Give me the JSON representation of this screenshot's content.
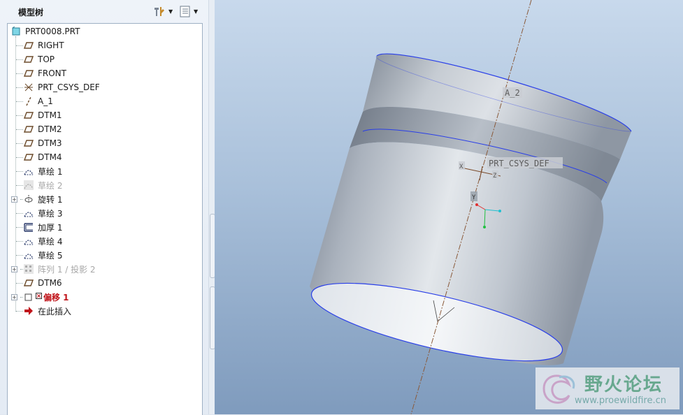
{
  "model_tree": {
    "title": "模型树",
    "root": "PRT0008.PRT",
    "items": [
      {
        "label": "RIGHT",
        "icon": "datum-plane-icon"
      },
      {
        "label": "TOP",
        "icon": "datum-plane-icon"
      },
      {
        "label": "FRONT",
        "icon": "datum-plane-icon"
      },
      {
        "label": "PRT_CSYS_DEF",
        "icon": "coordinate-system-icon"
      },
      {
        "label": "A_1",
        "icon": "datum-axis-icon"
      },
      {
        "label": "DTM1",
        "icon": "datum-plane-icon"
      },
      {
        "label": "DTM2",
        "icon": "datum-plane-icon"
      },
      {
        "label": "DTM3",
        "icon": "datum-plane-icon"
      },
      {
        "label": "DTM4",
        "icon": "datum-plane-icon"
      },
      {
        "label": "草绘 1",
        "icon": "sketch-icon"
      },
      {
        "label": "草绘 2",
        "icon": "sketch-icon",
        "state": "suppressed"
      },
      {
        "label": "旋转 1",
        "icon": "revolve-icon",
        "expandable": true
      },
      {
        "label": "草绘 3",
        "icon": "sketch-icon"
      },
      {
        "label": "加厚 1",
        "icon": "thicken-icon"
      },
      {
        "label": "草绘 4",
        "icon": "sketch-icon"
      },
      {
        "label": "草绘 5",
        "icon": "sketch-icon"
      },
      {
        "label": "阵列 1 / 投影 2",
        "icon": "pattern-icon",
        "state": "suppressed",
        "expandable": true
      },
      {
        "label": "DTM6",
        "icon": "datum-plane-icon"
      },
      {
        "label": "偏移 1",
        "icon": "offset-icon",
        "state": "error",
        "expandable": true
      },
      {
        "label": "在此插入",
        "icon": "insert-here-arrow-icon"
      }
    ]
  },
  "header_buttons": {
    "settings": "tree-settings-icon",
    "columns": "tree-columns-icon"
  },
  "viewport": {
    "labels": {
      "axis": "A_2",
      "csys": "PRT_CSYS_DEF",
      "csys_x": "X",
      "csys_y": "Y",
      "csys_z": "Z"
    }
  },
  "watermark": {
    "title": "野火论坛",
    "url": "www.proewildfire.cn"
  },
  "colors": {
    "edge_highlight": "#2a3fe8",
    "error_text": "#c0141a",
    "viewport_top": "#c8d9ec",
    "viewport_bottom": "#7f9bbd"
  }
}
